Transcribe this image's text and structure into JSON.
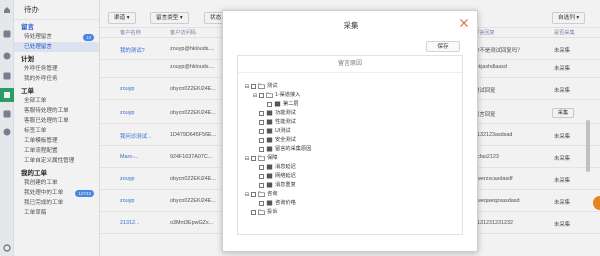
{
  "sidebar": {
    "header": "待办",
    "groups": [
      {
        "title": "留言",
        "items": [
          {
            "label": "待处理留言",
            "badge": "13"
          },
          {
            "label": "已处理留言",
            "badge": ""
          }
        ]
      },
      {
        "title": "计划",
        "items": [
          {
            "label": "外呼任务管理",
            "badge": ""
          },
          {
            "label": "我的外呼任务",
            "badge": ""
          }
        ]
      },
      {
        "title": "工单",
        "items": [
          {
            "label": "全部工单",
            "badge": ""
          },
          {
            "label": "客服待处理的工单",
            "badge": ""
          },
          {
            "label": "客服已处理的工单",
            "badge": ""
          },
          {
            "label": "标签工单",
            "badge": ""
          },
          {
            "label": "工单模板管理",
            "badge": ""
          },
          {
            "label": "工单流程配置",
            "badge": ""
          },
          {
            "label": "工单自定义属性管理",
            "badge": ""
          }
        ]
      },
      {
        "title": "我的工单",
        "items": [
          {
            "label": "我创建的工单",
            "badge": ""
          },
          {
            "label": "我处理中的工单",
            "badge": "12743"
          },
          {
            "label": "我已完成的工单",
            "badge": ""
          },
          {
            "label": "工单草稿",
            "badge": ""
          }
        ]
      }
    ]
  },
  "toolbar": {
    "btn1": "渠道 ▾",
    "btn2": "留言类型 ▾",
    "btn3": "状态",
    "right_btn": "自选列 ▾"
  },
  "table": {
    "headers": [
      "客户名称",
      "客户访问码",
      "留言回复",
      "是否采集"
    ],
    "rows": [
      {
        "name": "我的测试?",
        "code": "zouyp@hklouds....",
        "reply": "你不是测试回复吗？",
        "status": "未采集",
        "kind": "text"
      },
      {
        "name": "",
        "code": "zouyp@hklouds....",
        "reply": "fgkjashdlaasd",
        "status": "未采集",
        "kind": "text"
      },
      {
        "name": "zouyp",
        "code": "obycn022EKi24E...",
        "reply": "测试回复",
        "status": "未采集",
        "kind": "text"
      },
      {
        "name": "zouyp",
        "code": "obycn022EKi24E...",
        "reply": "留言回复",
        "status": "采集",
        "kind": "button"
      },
      {
        "name": "我问诊测试...",
        "code": "1D479D645F56E...",
        "reply": "2132123asdsad",
        "status": "未采集",
        "kind": "text"
      },
      {
        "name": "Mars-...",
        "code": "924F1637A07C...",
        "reply": "acfas2123",
        "status": "未采集",
        "kind": "text"
      },
      {
        "name": "zouyp",
        "code": "obycn022EKi24E...",
        "reply": "qwerzxcasdasdf",
        "status": "未采集",
        "kind": "text"
      },
      {
        "name": "zouyp",
        "code": "obycn022EKi24E...",
        "reply": "qweqweqzxasdasd",
        "status": "未采集",
        "kind": "text"
      },
      {
        "name": "21312...",
        "code": "o3Mnt3EpwGZx...",
        "reply": "2131231231232",
        "status": "未采集",
        "kind": "text"
      }
    ]
  },
  "dialog": {
    "title": "采集",
    "save": "保存",
    "panel_title": "留言原因",
    "tree": [
      {
        "level": 0,
        "toggle": "⊟",
        "label": "测试"
      },
      {
        "level": 1,
        "toggle": "⊟",
        "label": "1-渠道接入"
      },
      {
        "level": 2,
        "toggle": "",
        "label": "第二层"
      },
      {
        "level": 1,
        "toggle": "",
        "label": "功能测试"
      },
      {
        "level": 1,
        "toggle": "",
        "label": "性能测试"
      },
      {
        "level": 1,
        "toggle": "",
        "label": "UI测试"
      },
      {
        "level": 1,
        "toggle": "",
        "label": "安全测试"
      },
      {
        "level": 1,
        "toggle": "",
        "label": "留言的采集原因"
      },
      {
        "level": 0,
        "toggle": "⊟",
        "label": "保障"
      },
      {
        "level": 1,
        "toggle": "",
        "label": "消息延迟"
      },
      {
        "level": 1,
        "toggle": "",
        "label": "网络延迟"
      },
      {
        "level": 1,
        "toggle": "",
        "label": "消息重复"
      },
      {
        "level": 0,
        "toggle": "⊟",
        "label": "咨询"
      },
      {
        "level": 1,
        "toggle": "",
        "label": "咨询价格"
      },
      {
        "level": 0,
        "toggle": "",
        "label": "投诉"
      }
    ]
  },
  "colors": {
    "accent": "#2a5bd7",
    "close": "#e8593a",
    "rail_active": "#2aa86b",
    "fab": "#f28b1e"
  }
}
